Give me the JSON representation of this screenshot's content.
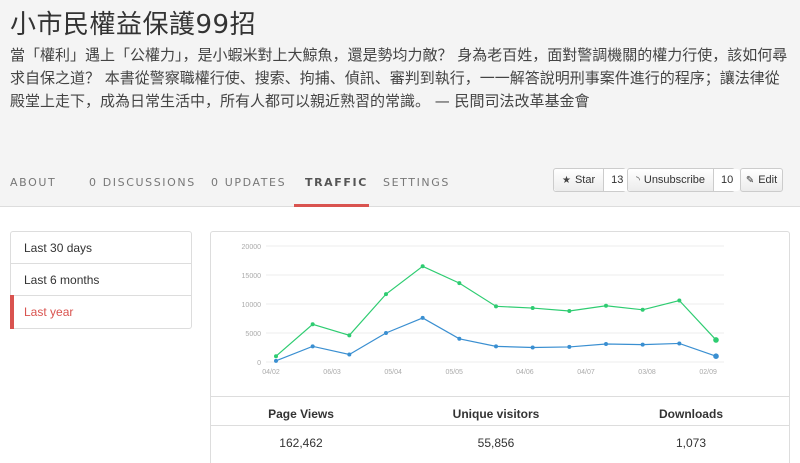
{
  "repo": {
    "title": "小市民權益保護99招",
    "description": "當「權利」遇上「公權力」，是小蝦米對上大鯨魚，還是勢均力敵？ 身為老百姓，面對警調機關的權力行使，該如何尋求自保之道？ 本書從警察職權行使、搜索、拘捕、偵訊、審判到執行，一一解答說明刑事案件進行的程序；讓法律從殿堂上走下，成為日常生活中，所有人都可以親近熟習的常識。 — 民間司法改革基金會"
  },
  "tabs": [
    {
      "label": "ABOUT"
    },
    {
      "label": "0 DISCUSSIONS"
    },
    {
      "label": "0 UPDATES"
    },
    {
      "label": "TRAFFIC"
    },
    {
      "label": "SETTINGS"
    }
  ],
  "actions": {
    "star_label": "Star",
    "star_count": "13",
    "unsubscribe_label": "Unsubscribe",
    "unsubscribe_count": "10",
    "edit_label": "Edit"
  },
  "ranges": [
    {
      "label": "Last 30 days"
    },
    {
      "label": "Last 6 months"
    },
    {
      "label": "Last year"
    }
  ],
  "stats": {
    "headers": [
      "Page Views",
      "Unique visitors",
      "Downloads"
    ],
    "values": [
      "162,462",
      "55,856",
      "1,073"
    ]
  },
  "colors": {
    "accent": "#d9534f",
    "series_green": "#2ecc71",
    "series_blue": "#3a8fd1"
  },
  "chart_data": {
    "type": "line",
    "ylim": [
      0,
      20000
    ],
    "yticks": [
      0,
      5000,
      10000,
      15000,
      20000
    ],
    "ytick_labels": [
      "0",
      "5000",
      "10000",
      "15000",
      "20000"
    ],
    "xtick_labels": [
      "04/02",
      "06/03",
      "05/04",
      "05/05",
      "04/06",
      "04/07",
      "03/08",
      "02/09"
    ],
    "series": [
      {
        "color": "#2ecc71",
        "values": [
          1000,
          6500,
          4600,
          11700,
          16500,
          13600,
          9600,
          9300,
          8800,
          9700,
          9000,
          10600,
          3800
        ]
      },
      {
        "color": "#3a8fd1",
        "values": [
          200,
          2700,
          1300,
          5000,
          7600,
          4000,
          2700,
          2500,
          2600,
          3100,
          3000,
          3200,
          1000
        ]
      }
    ]
  }
}
